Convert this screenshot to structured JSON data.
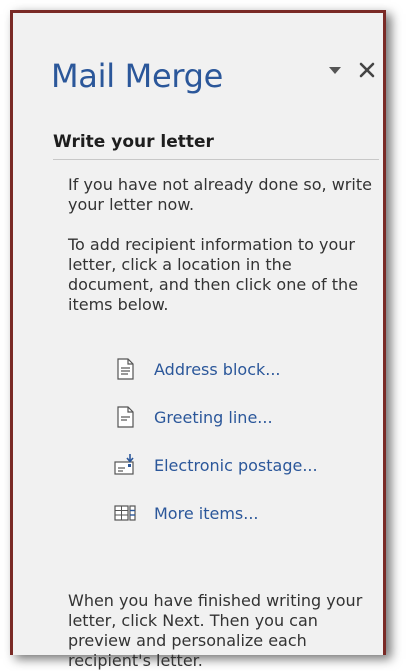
{
  "pane": {
    "title": "Mail Merge",
    "menu_icon": "dropdown-arrow-icon",
    "close_icon": "close-icon"
  },
  "section": {
    "heading": "Write your letter",
    "intro_text": "If you have not already done so, write your letter now.",
    "instruction_text": "To add recipient information to your letter, click a location in the document, and then click one of the items below.",
    "links": [
      {
        "label": "Address block...",
        "icon": "address-block-icon"
      },
      {
        "label": "Greeting line...",
        "icon": "greeting-line-icon"
      },
      {
        "label": "Electronic postage...",
        "icon": "electronic-postage-icon"
      },
      {
        "label": "More items...",
        "icon": "more-items-icon"
      }
    ],
    "finish_text": "When you have finished writing your letter, click Next. Then you can preview and personalize each recipient's letter."
  },
  "colors": {
    "accent": "#2b579a",
    "frame_border": "#7a2a26",
    "pane_background": "#f1f1f1"
  }
}
